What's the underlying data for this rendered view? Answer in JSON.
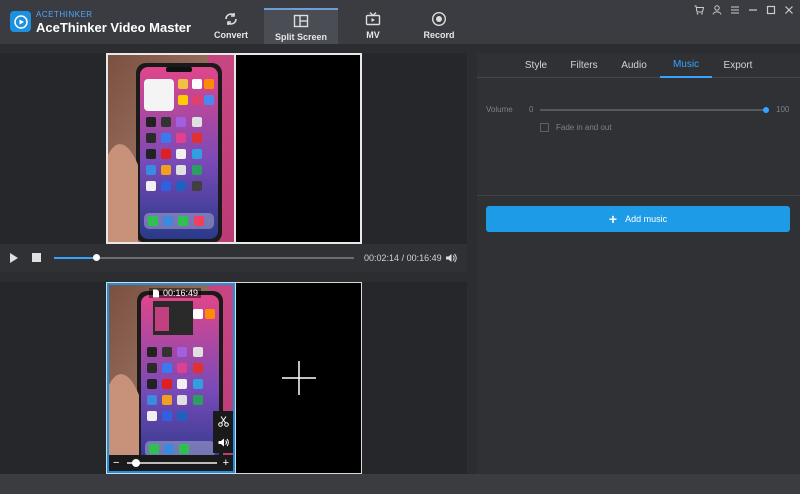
{
  "app": {
    "brand_small": "ACETHINKER",
    "title": "AceThinker Video Master"
  },
  "nav": {
    "tabs": [
      {
        "label": "Convert",
        "icon": "refresh-icon"
      },
      {
        "label": "Split Screen",
        "icon": "split-screen-icon",
        "active": true
      },
      {
        "label": "MV",
        "icon": "tv-icon"
      },
      {
        "label": "Record",
        "icon": "record-icon"
      }
    ]
  },
  "window_controls": [
    "cart-icon",
    "user-icon",
    "menu-icon",
    "minimize-icon",
    "maximize-icon",
    "close-icon"
  ],
  "player": {
    "current_time": "00:02:14",
    "separator": "/",
    "total_time": "00:16:49",
    "progress": 0.14
  },
  "clip": {
    "duration": "00:16:49",
    "zoom_minus": "−",
    "zoom_plus": "+",
    "zoom_level": 0.1
  },
  "right_panel": {
    "tabs": [
      "Style",
      "Filters",
      "Audio",
      "Music",
      "Export"
    ],
    "active_tab": "Music",
    "volume": {
      "label": "Volume",
      "min": "0",
      "max": "100",
      "value": 100
    },
    "fade": {
      "label": "Fade in and out",
      "checked": false
    },
    "add_music_label": "Add music"
  },
  "colors": {
    "accent": "#1e9be6",
    "clip_border": "#1e90e0",
    "panel_bg": "#2f3135"
  }
}
